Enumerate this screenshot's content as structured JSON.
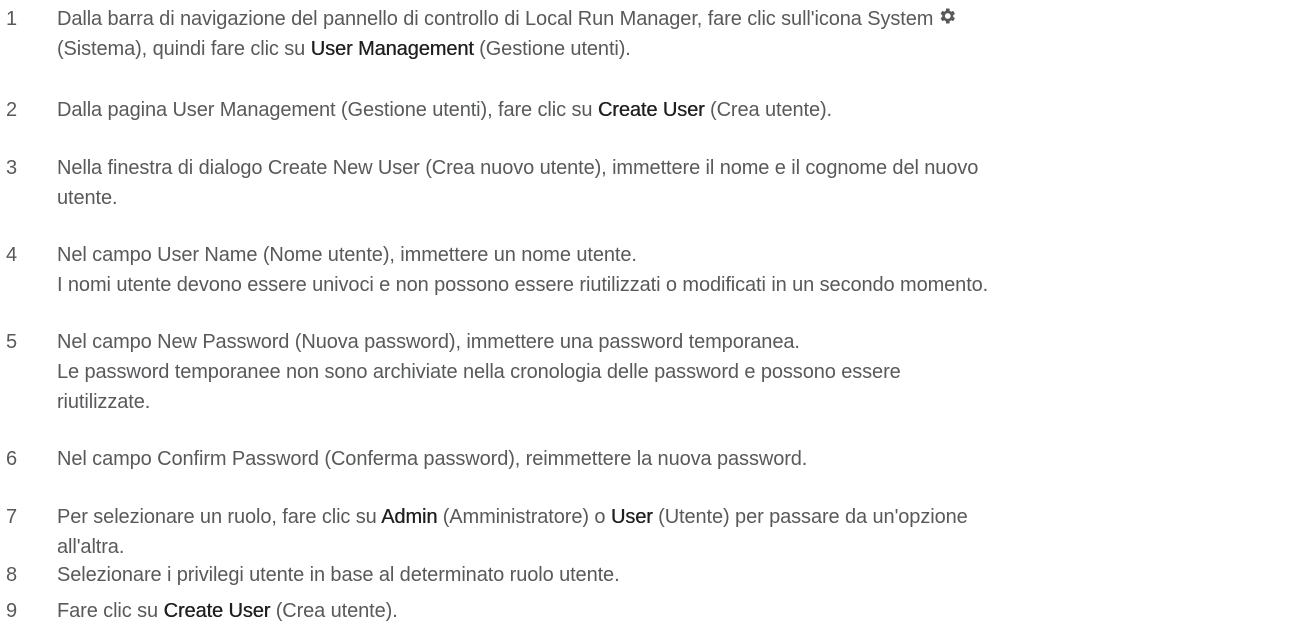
{
  "steps": [
    {
      "number": "1",
      "lines": [
        {
          "a": "Dalla barra di navigazione del pannello di controllo di Local Run Manager, fare clic sull'icona System"
        },
        {
          "a": "(Sistema), quindi fare clic su ",
          "b": "User Management",
          "c": " (Gestione utenti)."
        }
      ],
      "icon": "gear-icon"
    },
    {
      "number": "2",
      "lines": [
        {
          "a": "Dalla pagina User Management (Gestione utenti), fare clic su ",
          "b": "Create User",
          "c": " (Crea utente)."
        }
      ]
    },
    {
      "number": "3",
      "lines": [
        {
          "a": "Nella finestra di dialogo Create New User (Crea nuovo utente), immettere il nome e il cognome del nuovo"
        },
        {
          "a": "utente."
        }
      ]
    },
    {
      "number": "4",
      "lines": [
        {
          "a": "Nel campo User Name (Nome utente), immettere un nome utente."
        },
        {
          "a": "I nomi utente devono essere univoci e non possono essere riutilizzati o modificati in un secondo momento."
        }
      ]
    },
    {
      "number": "5",
      "lines": [
        {
          "a": "Nel campo New Password (Nuova password), immettere una password temporanea."
        },
        {
          "a": "Le password temporanee non sono archiviate nella cronologia delle password e possono essere"
        },
        {
          "a": "riutilizzate."
        }
      ]
    },
    {
      "number": "6",
      "lines": [
        {
          "a": "Nel campo Confirm Password (Conferma password), reimmettere la nuova password."
        }
      ]
    },
    {
      "number": "7",
      "lines": [
        {
          "a": "Per selezionare un ruolo, fare clic su ",
          "b": "Admin",
          "c": " (Amministratore) o ",
          "d": "User",
          "e": " (Utente) per passare da un'opzione"
        },
        {
          "a": "all'altra."
        }
      ]
    },
    {
      "number": "8",
      "lines": [
        {
          "a": "Selezionare i privilegi utente in base al determinato ruolo utente."
        }
      ]
    },
    {
      "number": "9",
      "lines": [
        {
          "a": "Fare clic su ",
          "b": "Create User",
          "c": " (Crea utente)."
        }
      ]
    }
  ]
}
